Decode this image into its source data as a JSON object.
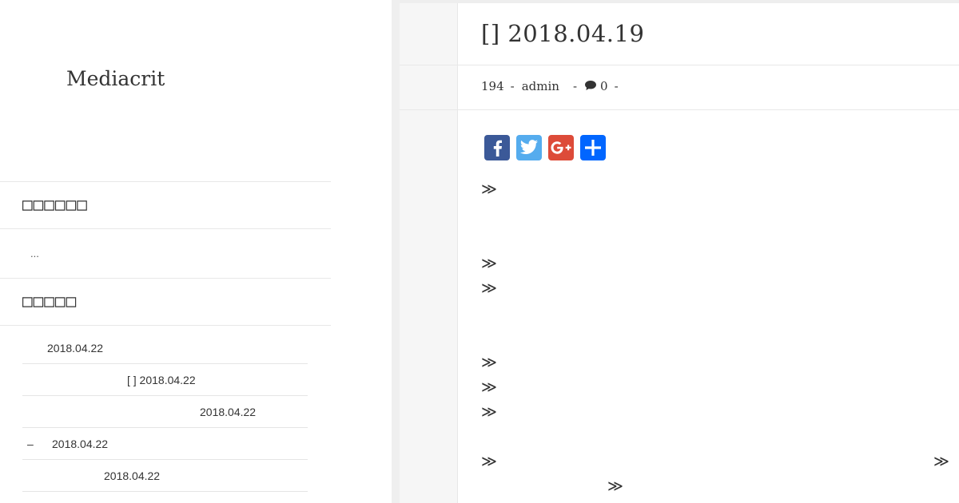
{
  "site": {
    "title": "Mediacrit"
  },
  "widgets": [
    {
      "title": "□□□□□□",
      "body": "..."
    },
    {
      "title": "□□□□□",
      "recent_posts": [
        {
          "label": "2018.04.22"
        },
        {
          "label": "[ ] 2018.04.22"
        },
        {
          "label": "2018.04.22"
        },
        {
          "label": "2018.04.22",
          "prefix": "–"
        },
        {
          "label": "2018.04.22"
        }
      ]
    }
  ],
  "post": {
    "title": "[] 2018.04.19",
    "meta": {
      "views": "194",
      "author": "admin",
      "comments": "0",
      "separator": "-"
    },
    "share_buttons": [
      {
        "name": "facebook",
        "color": "#3b5998",
        "icon": "facebook-icon"
      },
      {
        "name": "twitter",
        "color": "#55acee",
        "icon": "twitter-icon"
      },
      {
        "name": "google-plus",
        "color": "#dd4b39",
        "icon": "google-plus-icon"
      },
      {
        "name": "share",
        "color": "#0166ff",
        "icon": "plus-icon"
      }
    ],
    "body_marker": "≫"
  }
}
